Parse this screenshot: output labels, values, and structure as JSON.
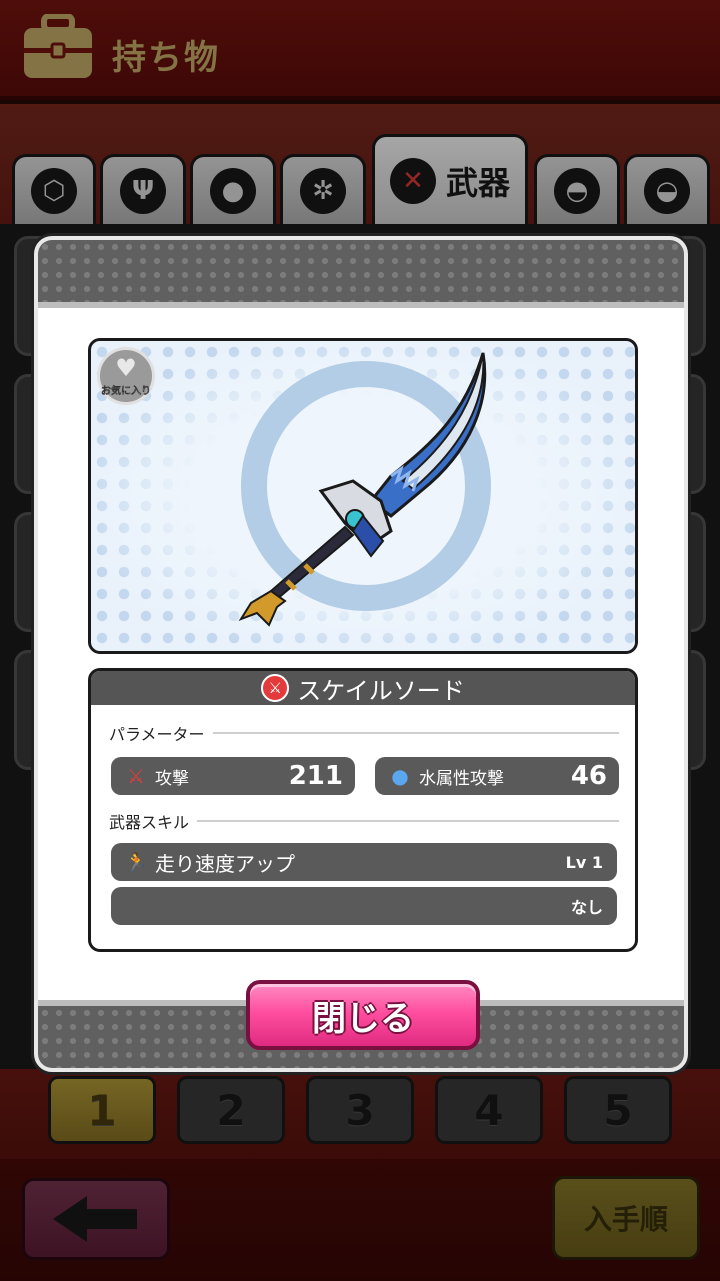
{
  "header": {
    "title": "持ち物",
    "icon": "bag-icon"
  },
  "tabs": [
    {
      "icon": "box-icon",
      "active": false
    },
    {
      "icon": "food-icon",
      "active": false
    },
    {
      "icon": "material-icon",
      "active": false
    },
    {
      "icon": "key-item-icon",
      "active": false
    },
    {
      "icon": "sword-icon",
      "label": "武器",
      "active": true
    },
    {
      "icon": "helmet-icon",
      "active": false
    },
    {
      "icon": "armor-icon",
      "active": false
    }
  ],
  "modal": {
    "favorite_label": "お気に入り",
    "item_name": "スケイルソード",
    "parameters_label": "パラメーター",
    "stats": [
      {
        "icon": "sword-stat-icon",
        "label": "攻撃",
        "value": "211"
      },
      {
        "icon": "water-drop-icon",
        "label": "水属性攻撃",
        "value": "46"
      }
    ],
    "skills_label": "武器スキル",
    "skills": [
      {
        "icon": "running-icon",
        "name": "走り速度アップ",
        "level": "Lv 1"
      },
      {
        "name": "",
        "level": "なし"
      }
    ],
    "close_label": "閉じる"
  },
  "pages": [
    "1",
    "2",
    "3",
    "4",
    "5"
  ],
  "active_page": "1",
  "bottom": {
    "back_icon": "back-arrow-icon",
    "sort_label": "入手順"
  },
  "colors": {
    "header": "#7a1510",
    "close_button": "#ff4fa0",
    "active_page": "#b59d38"
  }
}
